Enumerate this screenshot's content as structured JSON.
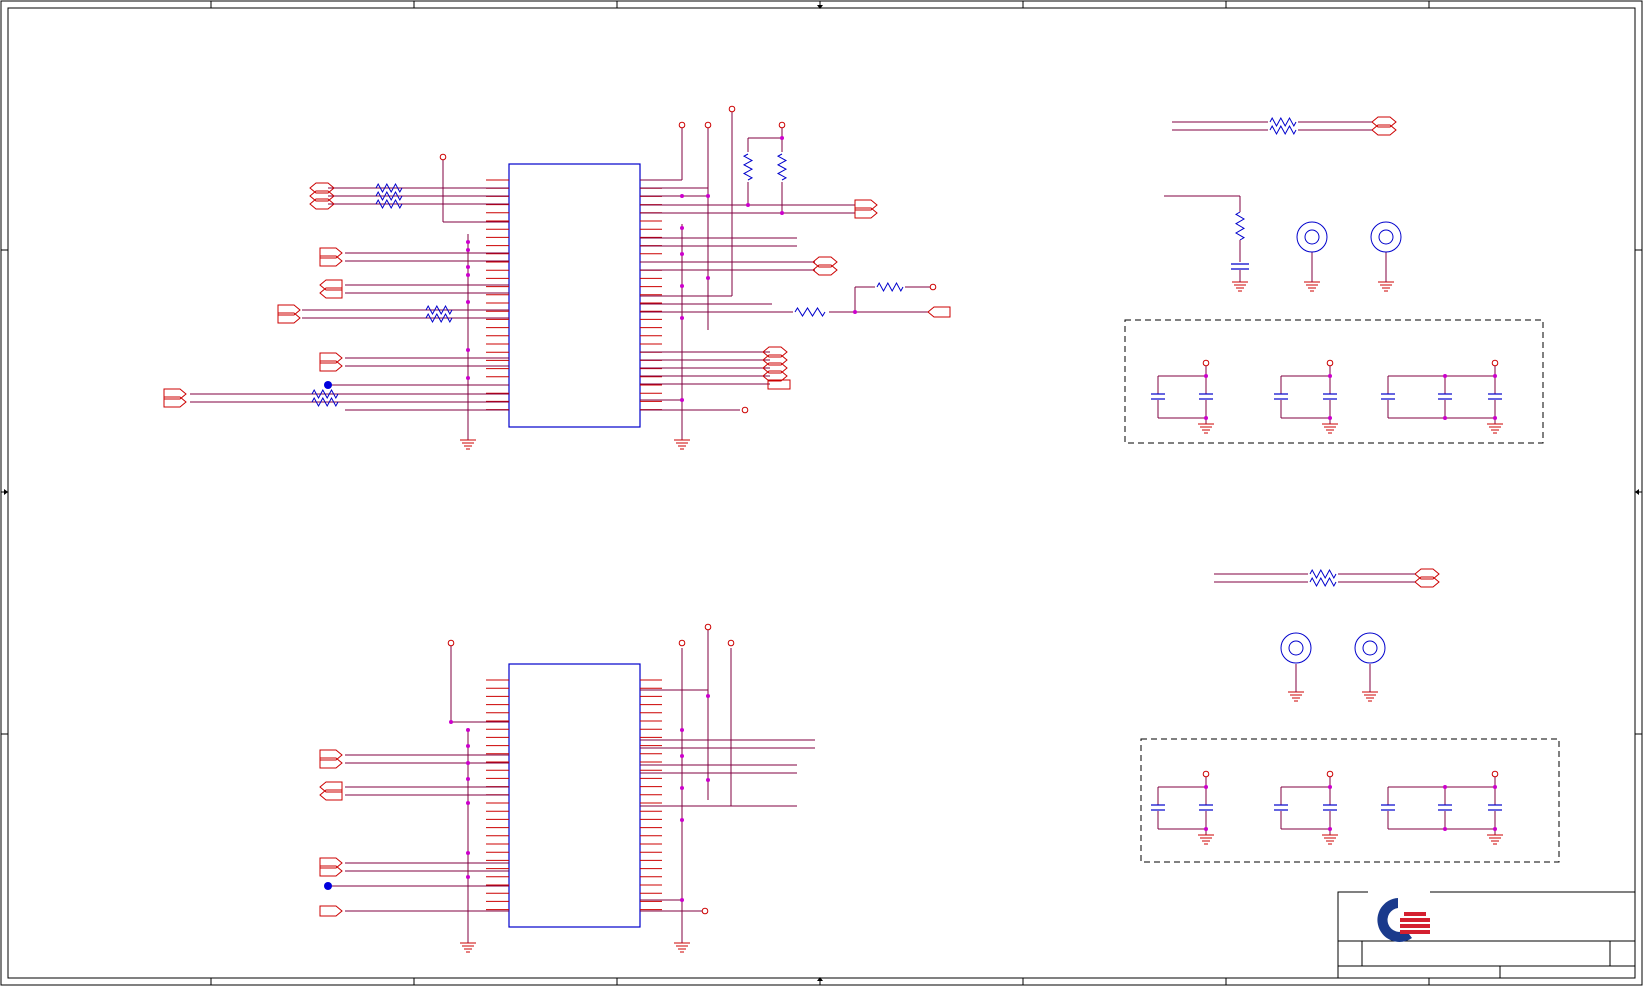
{
  "sheet": {
    "title": "",
    "logo": "company-logo-q-mark",
    "colors": {
      "wire": "#800040",
      "pin": "#cc0000",
      "part": "#0000cc",
      "junction": "#cc00cc",
      "ground": "#cc0000",
      "border": "#000000",
      "logo_blue": "#1a3a8c",
      "logo_red": "#d42030"
    }
  }
}
